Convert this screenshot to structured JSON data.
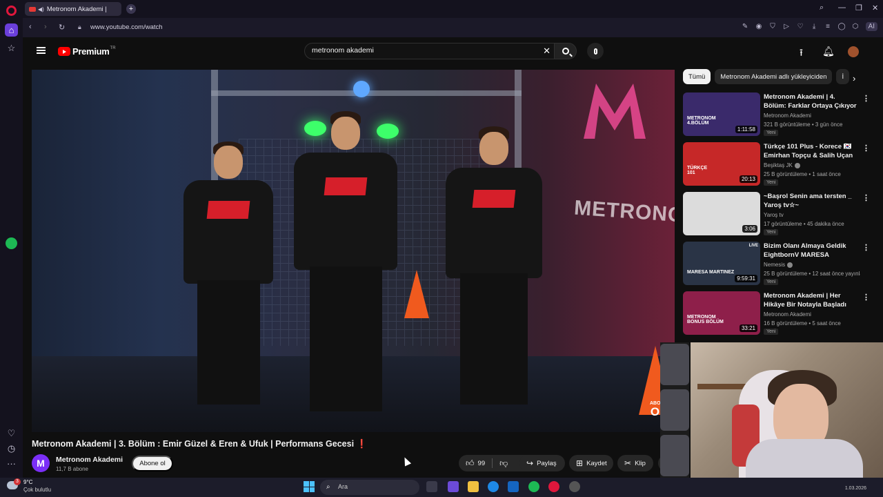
{
  "browser": {
    "tab_title": "Metronom Akademi |",
    "new_tab_label": "+",
    "url": "www.youtube.com/watch",
    "ai_label": "AI"
  },
  "youtube": {
    "logo_text": "Premium",
    "logo_region": "TR",
    "search_value": "metronom akademi",
    "search_placeholder": "Ara"
  },
  "video": {
    "title": "Metronom Akademi | 3. Bölüm : Emir Güzel & Eren & Ufuk | Performans Gecesi",
    "title_emoji": "❗",
    "overlay_small": "ABONE",
    "overlay_big": "OL",
    "set_sign": "METRONOM",
    "channel_initial": "M",
    "channel_name": "Metronom Akademi",
    "subscribers": "11,7 B abone",
    "subscribe_label": "Abone ol",
    "likes": "99",
    "share_label": "Paylaş",
    "save_label": "Kaydet",
    "clip_label": "Klip",
    "more_label": "···"
  },
  "chips": [
    "Tümü",
    "Metronom Akademi adlı yükleyiciden",
    "İ"
  ],
  "related": [
    {
      "title": "Metronom Akademi | 4. Bölüm: Farklar Ortaya Çıkıyor",
      "channel": "Metronom Akademi",
      "meta": "321 B görüntüleme • 3 gün önce",
      "badge": "Yeni",
      "duration": "1:11:58",
      "thumb_text": "METRONOM\n4.BÖLÜM",
      "thumb_color": "#3a2a6b",
      "verified": false,
      "live": false
    },
    {
      "title": "Türkçe 101 Plus - Korece 🇰🇷 Emirhan Topçu & Salih Uçan",
      "channel": "Beşiktaş JK",
      "meta": "25 B görüntüleme • 1 saat önce",
      "badge": "Yeni",
      "duration": "20:13",
      "thumb_text": "TÜRKÇE\n101",
      "thumb_color": "#c62828",
      "verified": true,
      "live": false
    },
    {
      "title": "~Başrol Senin ama tersten _ Yaroş tv☆~",
      "channel": "Yaroş tv",
      "meta": "17 görüntüleme • 45 dakika önce",
      "badge": "Yeni",
      "duration": "3:06",
      "thumb_text": "",
      "thumb_color": "#dcdcdc",
      "verified": false,
      "live": false
    },
    {
      "title": "Bizim Olanı Almaya Geldik EightbornV MARESA MARTIN...",
      "channel": "Nemesis",
      "meta": "25 B görüntüleme • 12 saat önce yayınla...",
      "badge": "Yeni",
      "duration": "9:59:31",
      "thumb_text": "MARESA MARTINEZ",
      "thumb_color": "#2a3446",
      "verified": true,
      "live": true,
      "live_label": "LIVE"
    },
    {
      "title": "Metronom Akademi | Her Hikâye Bir Notayla Başladı",
      "channel": "Metronom Akademi",
      "meta": "16 B görüntüleme • 5 saat önce",
      "badge": "Yeni",
      "duration": "33:21",
      "thumb_text": "METRONOM\nBONUS BÖLÜM",
      "thumb_color": "#8e1f4a",
      "verified": false,
      "live": false
    }
  ],
  "taskbar": {
    "notification_count": "3",
    "temperature": "9°C",
    "condition": "Çok bulutlu",
    "search_placeholder": "Ara",
    "clock": "1.03.2026"
  },
  "colors": {
    "youtube_red": "#ff0000",
    "opera_purple": "#6b3fdb",
    "spotify_green": "#1db954"
  }
}
